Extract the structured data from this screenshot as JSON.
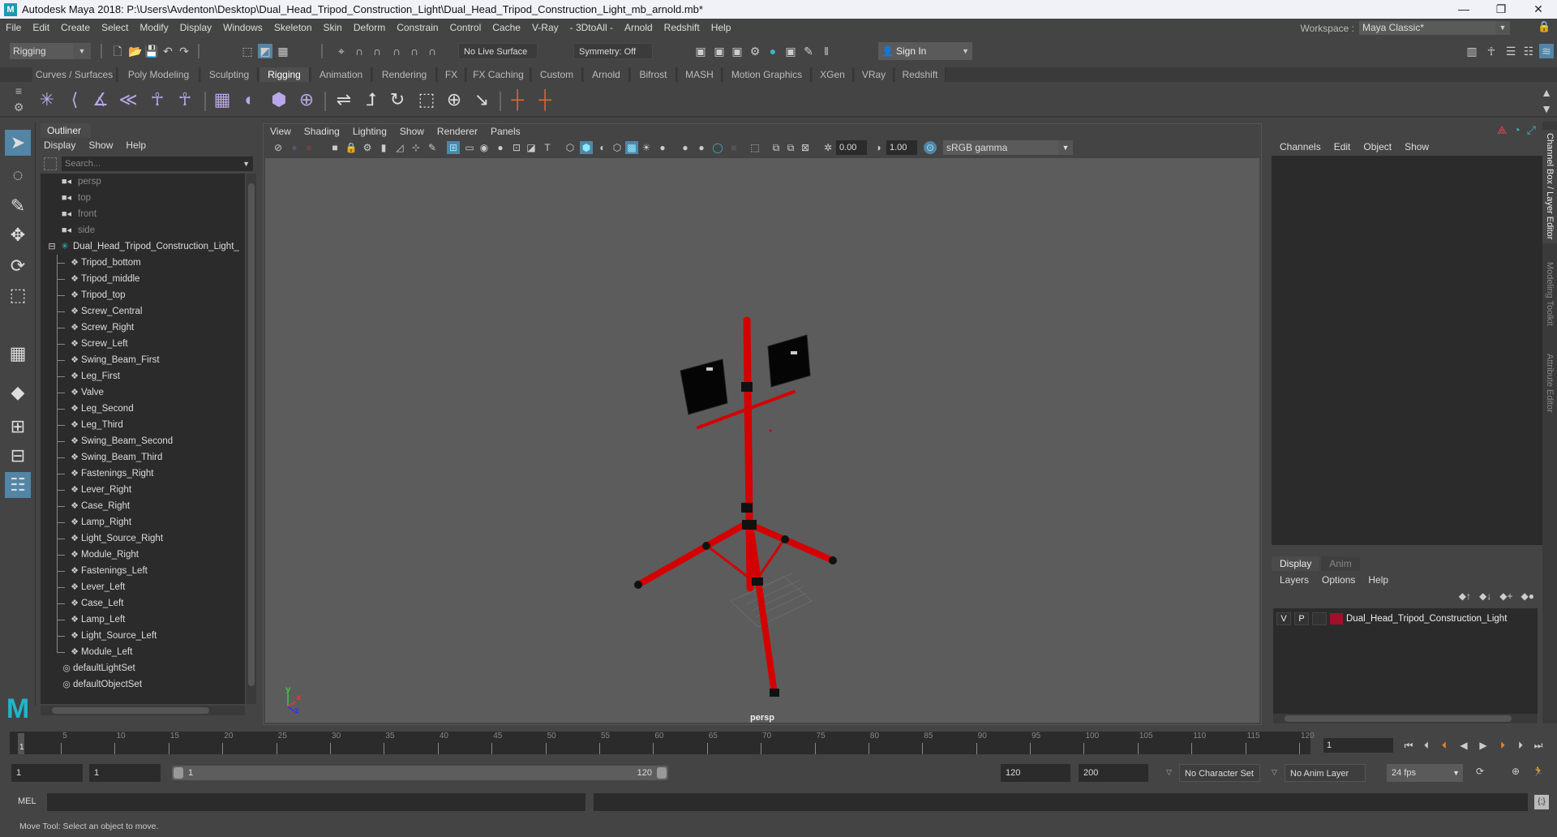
{
  "window": {
    "title": "Autodesk Maya 2018: P:\\Users\\Avdenton\\Desktop\\Dual_Head_Tripod_Construction_Light\\Dual_Head_Tripod_Construction_Light_mb_arnold.mb*",
    "logo": "M",
    "minimize": "—",
    "restore": "❐",
    "close": "✕"
  },
  "menubar": {
    "items": [
      "File",
      "Edit",
      "Create",
      "Select",
      "Modify",
      "Display",
      "Windows",
      "Skeleton",
      "Skin",
      "Deform",
      "Constrain",
      "Control",
      "Cache",
      "V-Ray",
      "- 3DtoAll -",
      "Arnold",
      "Redshift",
      "Help"
    ],
    "workspace_label": "Workspace :",
    "workspace_value": "Maya Classic*"
  },
  "statusline": {
    "mode": "Rigging",
    "live_surface": "No Live Surface",
    "symmetry": "Symmetry: Off",
    "sign_in": "Sign In"
  },
  "shelf": {
    "tabs": [
      "Curves / Surfaces",
      "Poly Modeling",
      "Sculpting",
      "Rigging",
      "Animation",
      "Rendering",
      "FX",
      "FX Caching",
      "Custom",
      "Arnold",
      "Bifrost",
      "MASH",
      "Motion Graphics",
      "XGen",
      "VRay",
      "Redshift"
    ],
    "active_tab": "Rigging"
  },
  "outliner": {
    "title": "Outliner",
    "menu": [
      "Display",
      "Show",
      "Help"
    ],
    "search_placeholder": "Search...",
    "cameras": [
      "persp",
      "top",
      "front",
      "side"
    ],
    "root": "Dual_Head_Tripod_Construction_Light_",
    "children": [
      "Tripod_bottom",
      "Tripod_middle",
      "Tripod_top",
      "Screw_Central",
      "Screw_Right",
      "Screw_Left",
      "Swing_Beam_First",
      "Leg_First",
      "Valve",
      "Leg_Second",
      "Leg_Third",
      "Swing_Beam_Second",
      "Swing_Beam_Third",
      "Fastenings_Right",
      "Lever_Right",
      "Case_Right",
      "Lamp_Right",
      "Light_Source_Right",
      "Module_Right",
      "Fastenings_Left",
      "Lever_Left",
      "Case_Left",
      "Lamp_Left",
      "Light_Source_Left",
      "Module_Left"
    ],
    "sets": [
      "defaultLightSet",
      "defaultObjectSet"
    ]
  },
  "viewport": {
    "menu": [
      "View",
      "Shading",
      "Lighting",
      "Show",
      "Renderer",
      "Panels"
    ],
    "exposure": "0.00",
    "gamma": "1.00",
    "color_space": "sRGB gamma",
    "camera_label": "persp",
    "axis": {
      "x": "x",
      "y": "y",
      "z": "z"
    }
  },
  "channelbox": {
    "menu": [
      "Channels",
      "Edit",
      "Object",
      "Show"
    ],
    "layer_tabs": [
      "Display",
      "Anim"
    ],
    "active_layer_tab": "Display",
    "layer_menu": [
      "Layers",
      "Options",
      "Help"
    ],
    "layer": {
      "v": "V",
      "p": "P",
      "name": "Dual_Head_Tripod_Construction_Light",
      "color": "#a0102a"
    }
  },
  "side_tabs": [
    "Channel Box / Layer Editor",
    "Modeling Toolkit",
    "Attribute Editor"
  ],
  "timeslider": {
    "ticks": [
      5,
      10,
      15,
      20,
      25,
      30,
      35,
      40,
      45,
      50,
      55,
      60,
      65,
      70,
      75,
      80,
      85,
      90,
      95,
      100,
      105,
      110,
      115,
      120
    ],
    "current_frame": "1",
    "frame_field": "1"
  },
  "rangeslider": {
    "start": "1",
    "playback_start": "1",
    "range_start": "1",
    "range_end": "120",
    "playback_end": "120",
    "end": "200",
    "character_set": "No Character Set",
    "anim_layer": "No Anim Layer",
    "fps": "24 fps"
  },
  "cmdline": {
    "label": "MEL"
  },
  "helpline": {
    "text": "Move Tool: Select an object to move."
  },
  "colors": {
    "accent": "#5285a6",
    "model_red": "#d40000",
    "layer_red": "#a0102a",
    "maya_teal": "#1fb6c9"
  }
}
